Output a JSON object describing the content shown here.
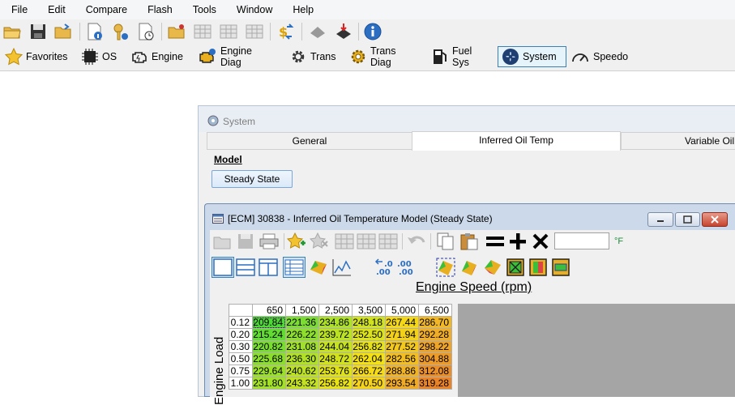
{
  "menu": [
    "File",
    "Edit",
    "Compare",
    "Flash",
    "Tools",
    "Window",
    "Help"
  ],
  "modules": [
    {
      "label": "Favorites",
      "icon": "star-icon"
    },
    {
      "label": "OS",
      "icon": "chip-icon"
    },
    {
      "label": "Engine",
      "icon": "engine-icon"
    },
    {
      "label": "Engine Diag",
      "icon": "engine-diag-icon"
    },
    {
      "label": "Trans",
      "icon": "gear-icon"
    },
    {
      "label": "Trans Diag",
      "icon": "gear-diag-icon"
    },
    {
      "label": "Fuel Sys",
      "icon": "fuel-pump-icon"
    },
    {
      "label": "System",
      "icon": "fan-icon",
      "active": true
    },
    {
      "label": "Speedo",
      "icon": "speedometer-icon"
    }
  ],
  "system_window": {
    "title": "System",
    "tabs": [
      "General",
      "Inferred Oil Temp",
      "Variable Oil"
    ],
    "active_tab": "Inferred Oil Temp",
    "model_label": "Model",
    "model_button": "Steady State"
  },
  "ecm_window": {
    "title": "[ECM] 30838 - Inferred Oil Temperature Model (Steady State)",
    "unit": "°F",
    "x_axis_title": "Engine Speed (rpm)",
    "y_axis_title": "Engine Load",
    "columns": [
      "650",
      "1,500",
      "2,500",
      "3,500",
      "5,000",
      "6,500"
    ],
    "rows": [
      {
        "label": "0.12",
        "values": [
          "209.84",
          "221.36",
          "234.86",
          "248.18",
          "267.44",
          "286.70"
        ]
      },
      {
        "label": "0.20",
        "values": [
          "215.24",
          "226.22",
          "239.72",
          "252.50",
          "271.94",
          "292.28"
        ]
      },
      {
        "label": "0.30",
        "values": [
          "220.82",
          "231.08",
          "244.04",
          "256.82",
          "277.52",
          "298.22"
        ]
      },
      {
        "label": "0.50",
        "values": [
          "225.68",
          "236.30",
          "248.72",
          "262.04",
          "282.56",
          "304.88"
        ]
      },
      {
        "label": "0.75",
        "values": [
          "229.64",
          "240.62",
          "253.76",
          "266.72",
          "288.86",
          "312.08"
        ]
      },
      {
        "label": "1.00",
        "values": [
          "231.80",
          "243.32",
          "256.82",
          "270.50",
          "293.54",
          "319.28"
        ]
      }
    ]
  }
}
